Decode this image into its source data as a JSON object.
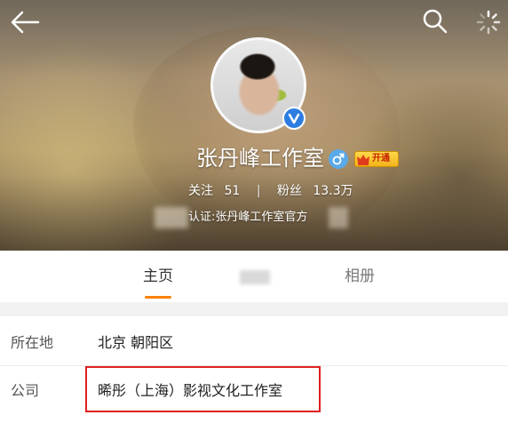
{
  "profile": {
    "name": "张丹峰工作室",
    "vip_label": "开通",
    "following_label": "关注",
    "following_count": "51",
    "separator": "|",
    "followers_label": "粉丝",
    "followers_count": "13.3万",
    "verification": "认证:张丹峰工作室官方"
  },
  "tabs": {
    "home": "主页",
    "album": "相册"
  },
  "info": {
    "location_label": "所在地",
    "location_value": "北京 朝阳区",
    "company_label": "公司",
    "company_value": "晞彤（上海）影视文化工作室"
  },
  "colors": {
    "accent": "#ff8200",
    "highlight_box": "#e02020",
    "verified_blue": "#2d7de1"
  },
  "icons": [
    "back-arrow-icon",
    "search-icon",
    "loading-spinner-icon",
    "verified-icon",
    "male-gender-icon",
    "vip-crown-icon"
  ]
}
